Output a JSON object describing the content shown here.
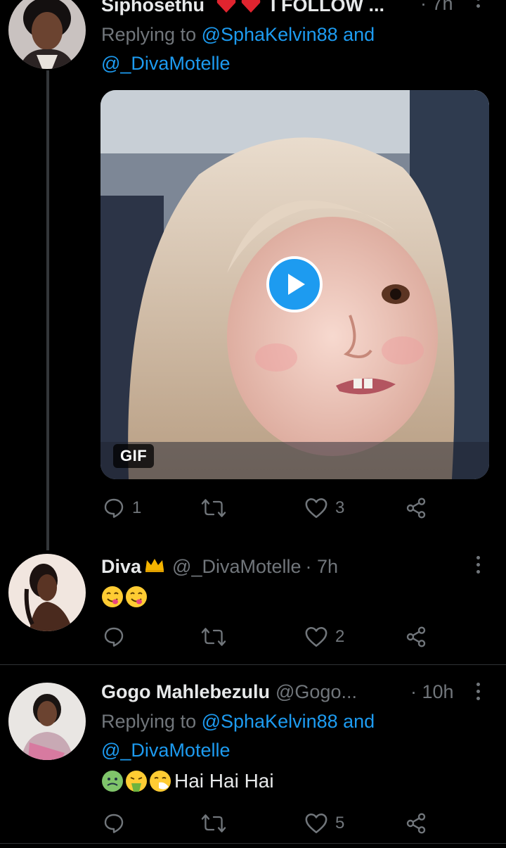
{
  "tweets": [
    {
      "name": "Siphosethu",
      "name_suffix": "I FOLLOW ...",
      "time": "· 7h",
      "replying_prefix": "Replying to ",
      "replying_to_1": "@SphaKelvin88",
      "replying_and": " and",
      "replying_to_2": "@_DivaMotelle",
      "media_badge": "GIF",
      "actions": {
        "replies": "1",
        "retweets": "",
        "likes": "3"
      }
    },
    {
      "name": "Diva",
      "handle": "@_DivaMotelle",
      "time": "· 7h",
      "text": "",
      "emojis": [
        "yum-emoji",
        "yum-emoji"
      ],
      "actions": {
        "replies": "",
        "retweets": "",
        "likes": "2"
      }
    },
    {
      "name": "Gogo Mahlebezulu",
      "handle": "@Gogo...",
      "time": "· 10h",
      "replying_prefix": "Replying to ",
      "replying_to_1": "@SphaKelvin88",
      "replying_and": " and",
      "replying_to_2": "@_DivaMotelle",
      "emojis": [
        "nauseated-emoji",
        "vomiting-emoji",
        "sneezing-emoji"
      ],
      "text": "Hai Hai Hai",
      "actions": {
        "replies": "",
        "retweets": "",
        "likes": "5"
      }
    }
  ],
  "colors": {
    "background": "#000000",
    "primary_text": "#e7e9ea",
    "secondary_text": "#71767b",
    "link": "#1d9bf0",
    "divider": "#2f3336"
  },
  "icons": [
    "reply-icon",
    "retweet-icon",
    "like-icon",
    "share-icon",
    "more-icon",
    "crown-icon",
    "heart-emoji",
    "play-icon"
  ]
}
